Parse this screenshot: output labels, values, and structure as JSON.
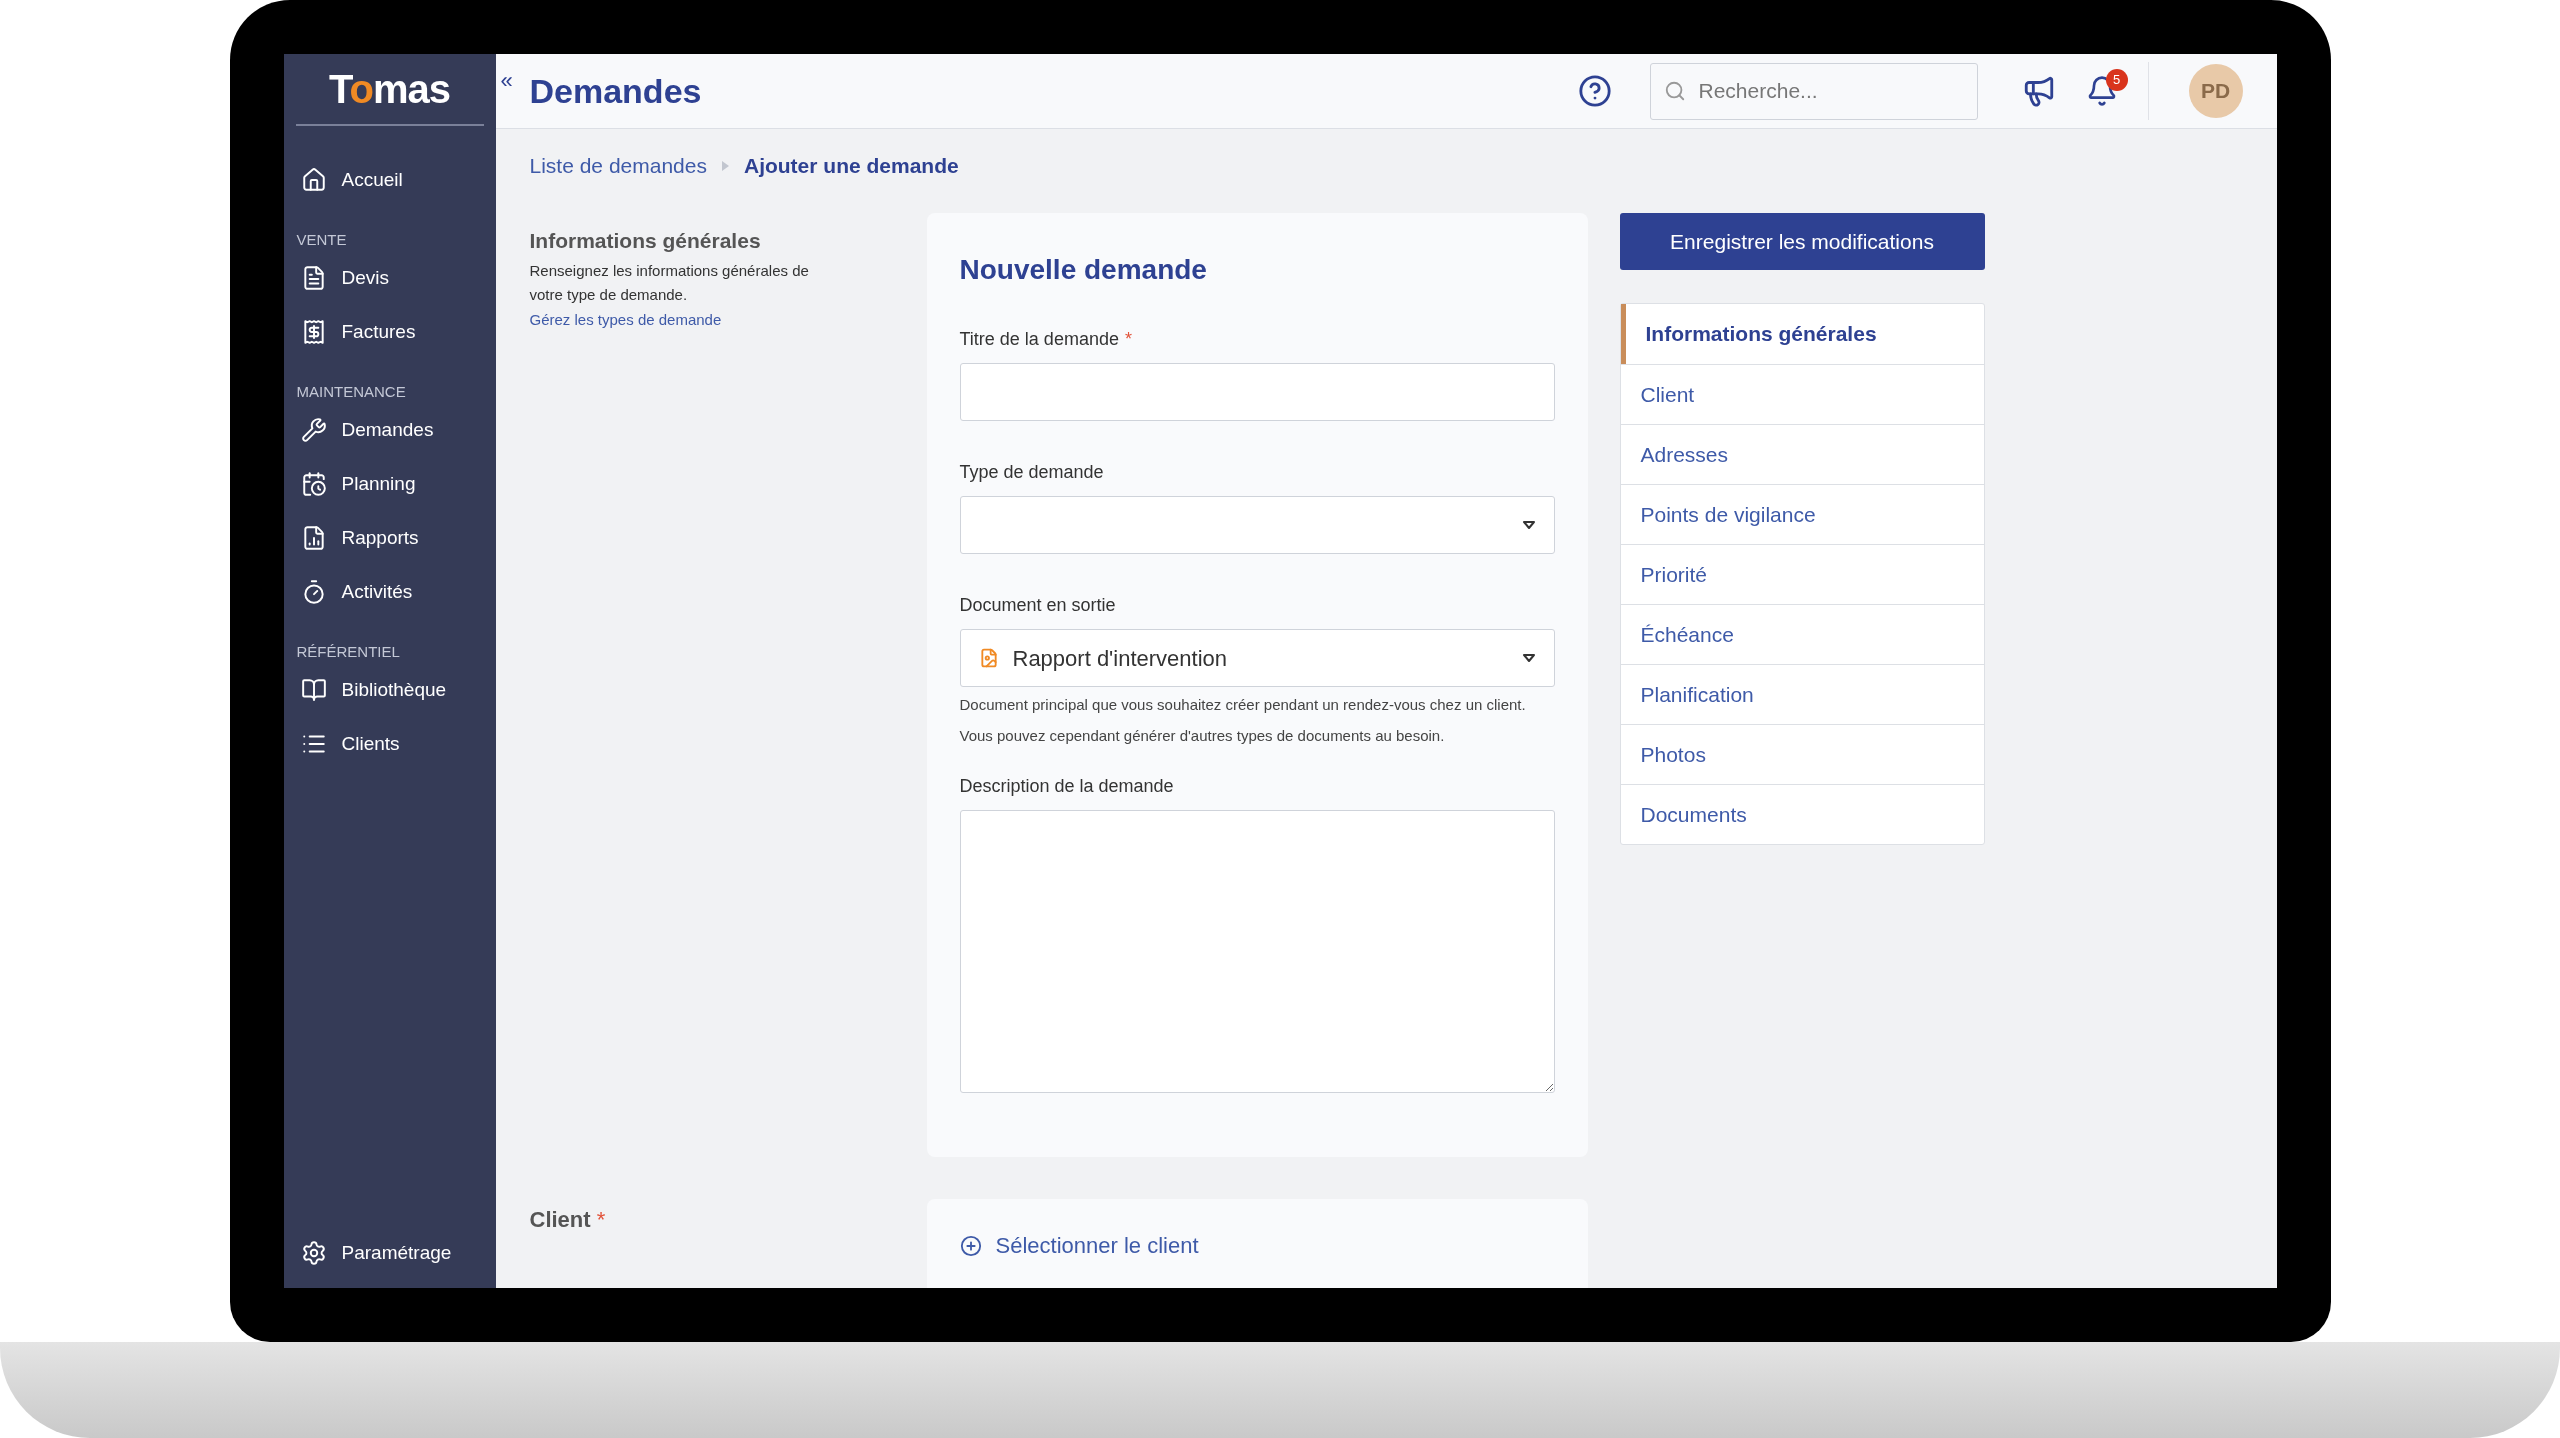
{
  "sidebar": {
    "logo": "Tomas",
    "sections": [
      {
        "items": [
          {
            "label": "Accueil"
          }
        ]
      },
      {
        "heading": "VENTE",
        "items": [
          {
            "label": "Devis"
          },
          {
            "label": "Factures"
          }
        ]
      },
      {
        "heading": "MAINTENANCE",
        "items": [
          {
            "label": "Demandes"
          },
          {
            "label": "Planning"
          },
          {
            "label": "Rapports"
          },
          {
            "label": "Activités"
          }
        ]
      },
      {
        "heading": "RÉFÉRENTIEL",
        "items": [
          {
            "label": "Bibliothèque"
          },
          {
            "label": "Clients"
          }
        ]
      }
    ],
    "footer_item": {
      "label": "Paramétrage"
    }
  },
  "header": {
    "collapse": "«",
    "title": "Demandes",
    "search": {
      "placeholder": "Recherche..."
    },
    "notifications": "5",
    "avatar": "PD"
  },
  "breadcrumb": [
    {
      "label": "Liste de demandes",
      "current": false
    },
    {
      "label": "Ajouter une demande",
      "current": true
    }
  ],
  "intro": {
    "title": "Informations générales",
    "description": "Renseignez les informations générales de votre type de demande.",
    "link": "Gérez les types de demande"
  },
  "form": {
    "title": "Nouvelle demande",
    "fields": [
      {
        "kind": "text",
        "label": "Titre de la demande",
        "required_mark": "*"
      },
      {
        "kind": "select",
        "label": "Type de demande"
      },
      {
        "kind": "select",
        "label": "Document en sortie",
        "value": "Rapport d'intervention",
        "help": "Document principal que vous souhaitez créer pendant un rendez-vous chez un client. Vous pouvez cependant générer d'autres types de documents au besoin."
      },
      {
        "kind": "textarea",
        "label": "Description de la demande"
      }
    ]
  },
  "client_section": {
    "label": "Client",
    "required_mark": "*",
    "action": "Sélectionner le client"
  },
  "save_button": "Enregistrer les modifications",
  "section_nav": [
    {
      "label": "Informations générales",
      "selected": true
    },
    {
      "label": "Client",
      "selected": false
    },
    {
      "label": "Adresses",
      "selected": false
    },
    {
      "label": "Points de vigilance",
      "selected": false
    },
    {
      "label": "Priorité",
      "selected": false
    },
    {
      "label": "Échéance",
      "selected": false
    },
    {
      "label": "Planification",
      "selected": false
    },
    {
      "label": "Photos",
      "selected": false
    },
    {
      "label": "Documents",
      "selected": false
    }
  ]
}
